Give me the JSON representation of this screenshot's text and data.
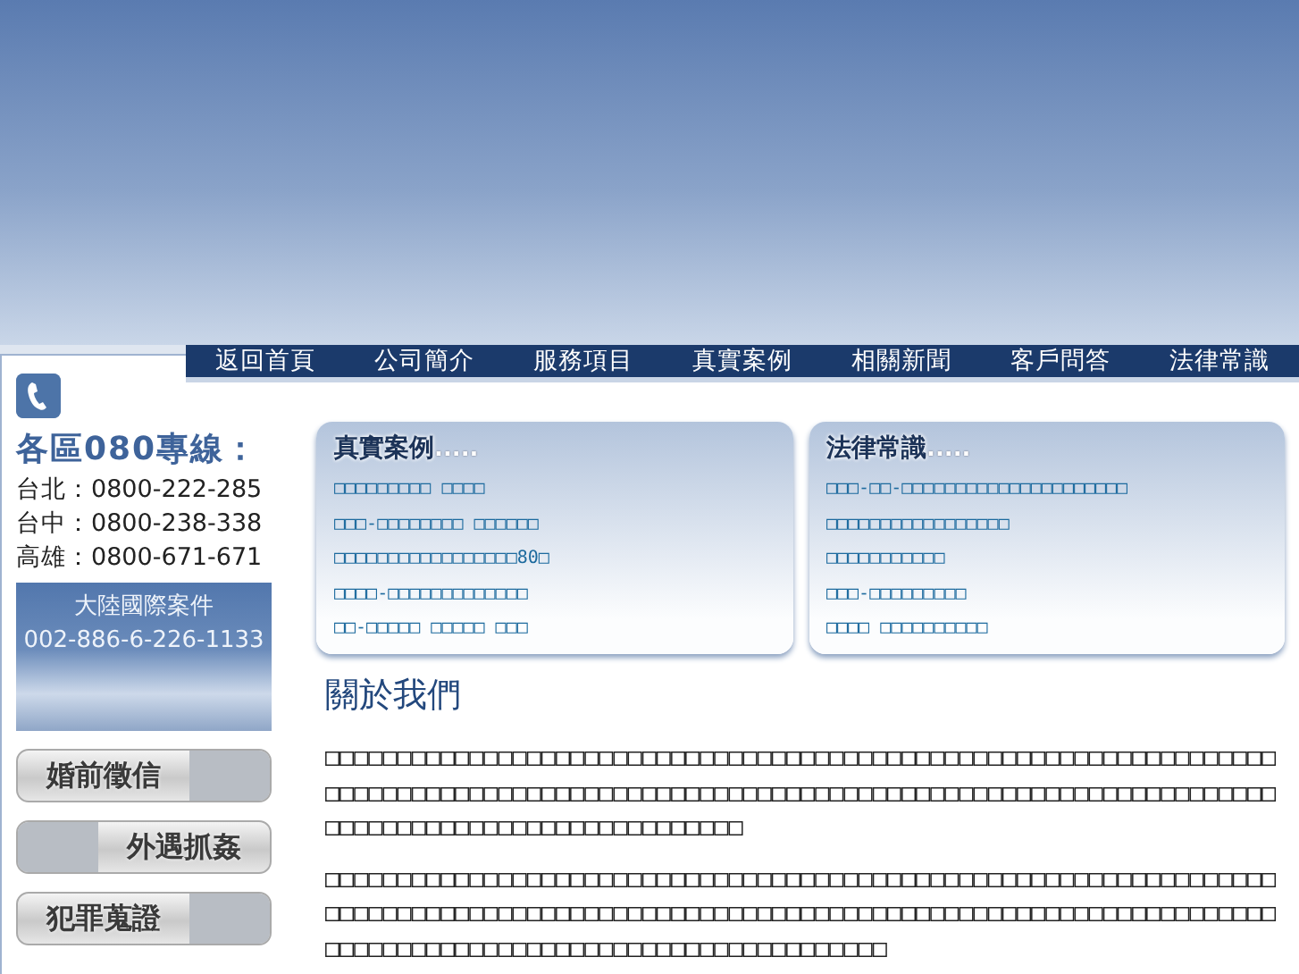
{
  "nav": [
    {
      "label": "返回首頁"
    },
    {
      "label": "公司簡介"
    },
    {
      "label": "服務項目"
    },
    {
      "label": "真實案例"
    },
    {
      "label": "相關新聞"
    },
    {
      "label": "客戶問答"
    },
    {
      "label": "法律常識"
    }
  ],
  "sidebar": {
    "hotline_title": "各區080專線：",
    "hotlines": [
      {
        "city": "台北：",
        "number": "0800-222-285"
      },
      {
        "city": "台中：",
        "number": "0800-238-338"
      },
      {
        "city": "高雄：",
        "number": "0800-671-671"
      }
    ],
    "banner": {
      "title": "大陸國際案件",
      "number": "002-886-6-226-1133"
    },
    "services": [
      {
        "label": "婚前徵信"
      },
      {
        "label": "外遇抓姦"
      },
      {
        "label": "犯罪蒐證"
      }
    ]
  },
  "boxes": [
    {
      "title": "真實案例",
      "dots": ".....",
      "links": [
        "□□□□□□□□□ □□□□",
        "□□□-□□□□□□□□ □□□□□□",
        "□□□□□□□□□□□□□□□□□80□",
        "□□□□-□□□□□□□□□□□□□",
        "□□-□□□□□ □□□□□ □□□"
      ]
    },
    {
      "title": "法律常識",
      "dots": ".....",
      "links": [
        "□□□-□□-□□□□□□□□□□□□□□□□□□□□□",
        "□□□□□□□□□□□□□□□□□",
        "□□□□□□□□□□□",
        "□□□-□□□□□□□□□",
        "□□□□ □□□□□□□□□□"
      ]
    }
  ],
  "about": {
    "heading": "關於我們",
    "paragraphs": [
      "□□□□□□□□□□□□□□□□□□□□□□□□□□□□□□□□□□□□□□□□□□□□□□□□□□□□□□□□□□□□□□□□□□□□□□□□□□□□□□□□□□□□□□□□□□□□□□□□□□□□□□□□□□□□□□□□□□□□□□□□□□□□□□□□□□□□□□□□□□□□□□□□□□□□□□□□□□□□□□□□□",
      "□□□□□□□□□□□□□□□□□□□□□□□□□□□□□□□□□□□□□□□□□□□□□□□□□□□□□□□□□□□□□□□□□□□□□□□□□□□□□□□□□□□□□□□□□□□□□□□□□□□□□□□□□□□□□□□□□□□□□□□□□□□□□□□□□□□□□□□□□□□□□□□□□□□□□□□□□□□□□□□□□□□□□□□□□□□"
    ]
  }
}
